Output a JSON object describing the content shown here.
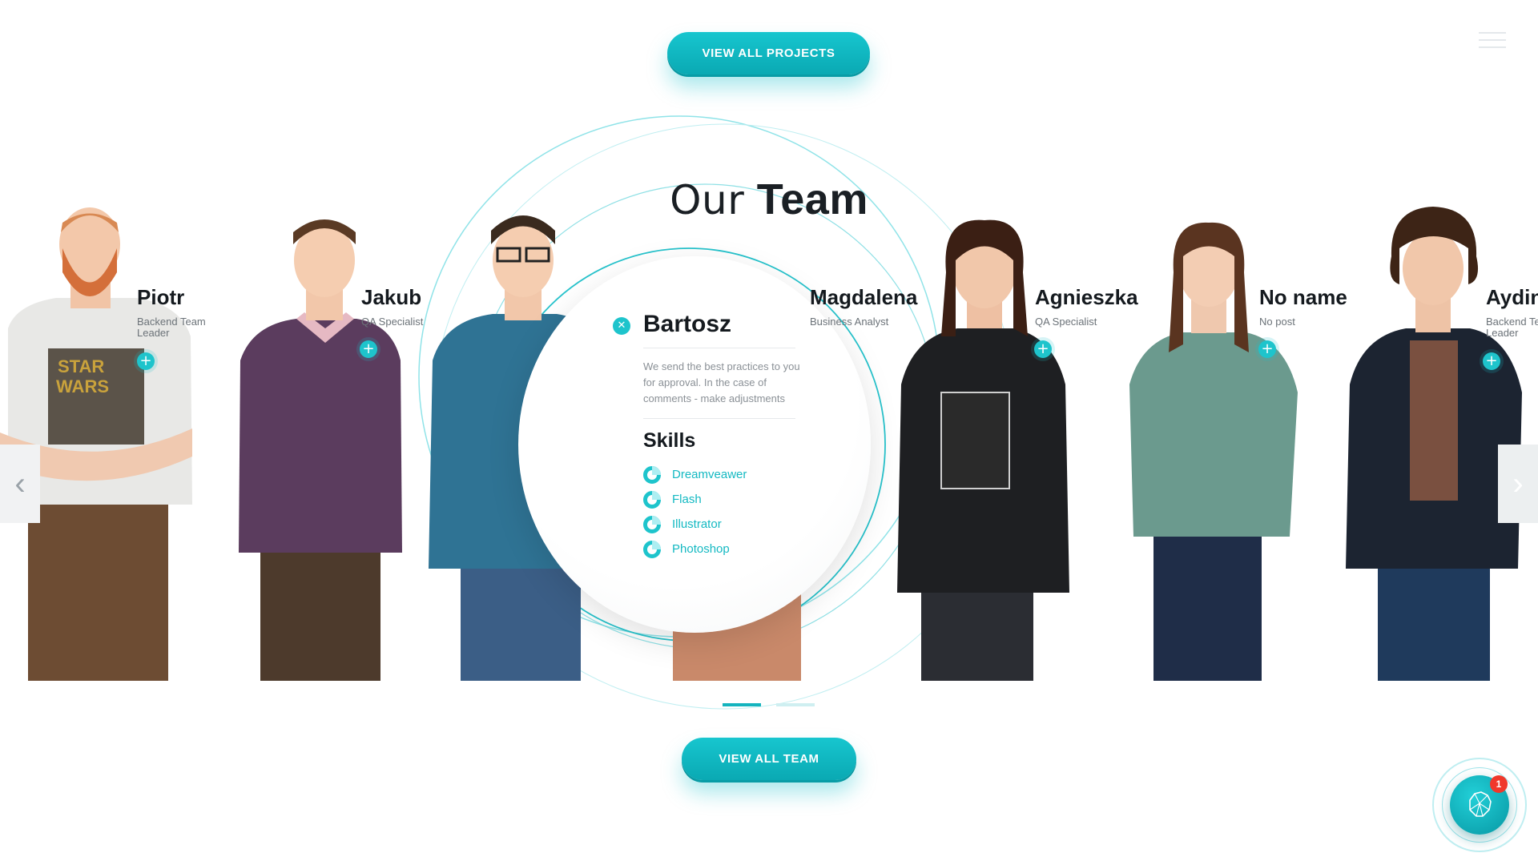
{
  "header": {
    "view_projects_label": "VIEW ALL PROJECTS",
    "menu_icon": "hamburger-menu-icon"
  },
  "team_section": {
    "title_light": "Our",
    "title_bold": "Team",
    "members": [
      {
        "name": "Piotr",
        "role": "Backend Team Leader"
      },
      {
        "name": "Jakub",
        "role": "QA Specialist"
      },
      {
        "name": "Magdalena",
        "role": "Business Analyst"
      },
      {
        "name": "Agnieszka",
        "role": "QA Specialist"
      },
      {
        "name": "No name",
        "role": "No post"
      },
      {
        "name": "Aydin",
        "role": "Backend Team Leader"
      }
    ],
    "featured": {
      "name": "Bartosz",
      "description": "We send the best practices to you for approval. In the case of comments - make adjustments",
      "skills_heading": "Skills",
      "skills": [
        "Dreamveawer",
        "Flash",
        "Illustrator",
        "Photoshop"
      ]
    },
    "view_team_label": "VIEW ALL TEAM",
    "pager": {
      "pages": 2,
      "active": 1
    }
  },
  "chat_widget": {
    "icon": "lion-logo-icon",
    "badge_count": "1"
  },
  "colors": {
    "accent": "#14b9c2",
    "text_dark": "#151a1f",
    "badge": "#f0382b"
  }
}
